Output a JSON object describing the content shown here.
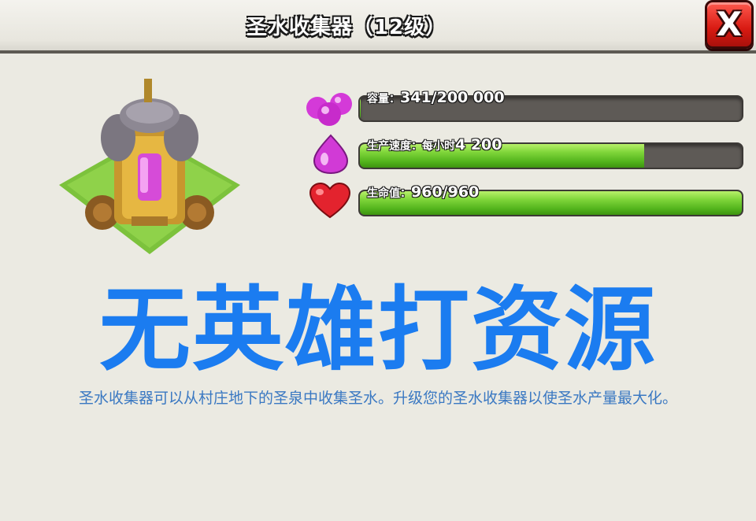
{
  "dialog": {
    "title": "圣水收集器（12级）",
    "close_label": "X"
  },
  "stats": [
    {
      "icon": "elixir-orbs-icon",
      "label": "容量：",
      "value": "341/200 000",
      "fill": 0.0017
    },
    {
      "icon": "elixir-drop-icon",
      "label": "生产速度：每小时",
      "value": "4 200",
      "fill": 0.745
    },
    {
      "icon": "heart-icon",
      "label": "生命值：",
      "value": "960/960",
      "fill": 1.0
    }
  ],
  "overlay_text": "无英雄打资源",
  "description": "圣水收集器可以从村庄地下的圣泉中收集圣水。升级您的圣水收集器以使圣水产量最大化。",
  "colors": {
    "bar_green": "#7fd53a",
    "bar_track": "#5e5a56",
    "overlay_blue": "#1b7cf0",
    "description_blue": "#3a78c2",
    "close_red": "#d81a12"
  }
}
